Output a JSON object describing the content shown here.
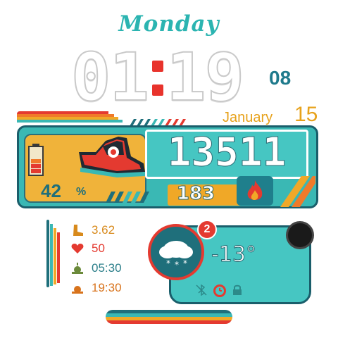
{
  "date": {
    "weekday": "Monday",
    "month": "January",
    "day": "15"
  },
  "time": {
    "hours": "01",
    "minutes": "19",
    "seconds": "08"
  },
  "activity": {
    "steps": "13511",
    "calories": "183",
    "battery_percent": "42",
    "battery_unit": "%",
    "battery_level": 0.42
  },
  "stats": {
    "distance": "3.62",
    "heart_rate": "50",
    "sunrise": "05:30",
    "sunset": "19:30"
  },
  "weather": {
    "temperature": "-13°",
    "notification_count": "2"
  },
  "icons": {
    "sneaker": "sneaker-icon",
    "battery": "battery-icon",
    "fire": "fire-icon",
    "boot": "boot-icon",
    "heart": "heart-icon",
    "sunrise": "sunrise-icon",
    "sunset": "sunset-icon",
    "weather": "snow-cloud-icon",
    "moon": "moon-phase-icon",
    "bluetooth_off": "bluetooth-off-icon",
    "alarm": "alarm-icon",
    "lock": "lock-icon"
  },
  "colors": {
    "teal": "#3ab8b4",
    "dark_teal": "#1f6f7b",
    "orange": "#f0a827",
    "red": "#e43a30",
    "text_amber": "#e7a21c"
  }
}
